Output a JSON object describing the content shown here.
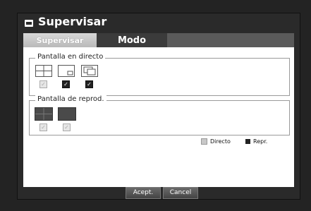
{
  "window": {
    "title": "Supervisar"
  },
  "tabs": [
    {
      "label": "Supervisar"
    },
    {
      "label": "Modo"
    }
  ],
  "group_live": {
    "title": "Pantalla en directo",
    "checks": [
      "disabled-checked",
      "checked",
      "checked"
    ]
  },
  "group_playback": {
    "title": "Pantalla de reprod.",
    "checks": [
      "disabled-checked",
      "disabled-checked"
    ]
  },
  "legend": {
    "live_label": "Directo",
    "playback_label": "Repr."
  },
  "buttons": {
    "ok_label": "Acept.",
    "cancel_label": "Cancel"
  }
}
